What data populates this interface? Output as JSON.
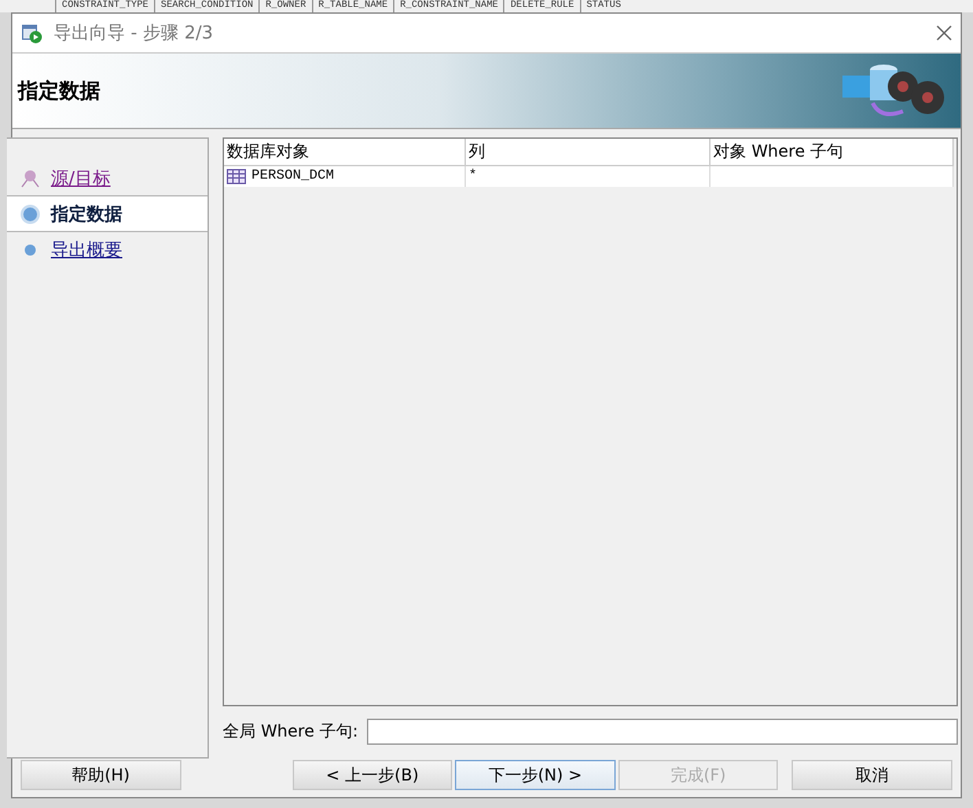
{
  "background_columns": [
    "CONSTRAINT_TYPE",
    "SEARCH_CONDITION",
    "R_OWNER",
    "R_TABLE_NAME",
    "R_CONSTRAINT_NAME",
    "DELETE_RULE",
    "STATUS"
  ],
  "window": {
    "title": "导出向导 - 步骤 2/3"
  },
  "banner": {
    "title": "指定数据"
  },
  "steps": [
    {
      "label": "源/目标",
      "selected": false,
      "visited": true
    },
    {
      "label": "指定数据",
      "selected": true,
      "visited": false
    },
    {
      "label": "导出概要",
      "selected": false,
      "visited": false
    }
  ],
  "table": {
    "columns": [
      "数据库对象",
      "列",
      "对象 Where 子句"
    ],
    "rows": [
      {
        "object": "PERSON_DCM",
        "columns": "*"
      }
    ]
  },
  "global_where": {
    "label": "全局 Where 子句:"
  },
  "buttons": [
    {
      "label": "帮助(H)",
      "kind": "help",
      "disabled": false,
      "focused": false
    },
    {
      "label": "< 上一步(B)",
      "kind": "nav",
      "disabled": false,
      "focused": false
    },
    {
      "label": "下一步(N) >",
      "kind": "nav",
      "disabled": false,
      "focused": true
    },
    {
      "label": "完成(F)",
      "kind": "nav",
      "disabled": true,
      "focused": false
    },
    {
      "label": "取消",
      "kind": "cancel",
      "disabled": false,
      "focused": false
    }
  ]
}
